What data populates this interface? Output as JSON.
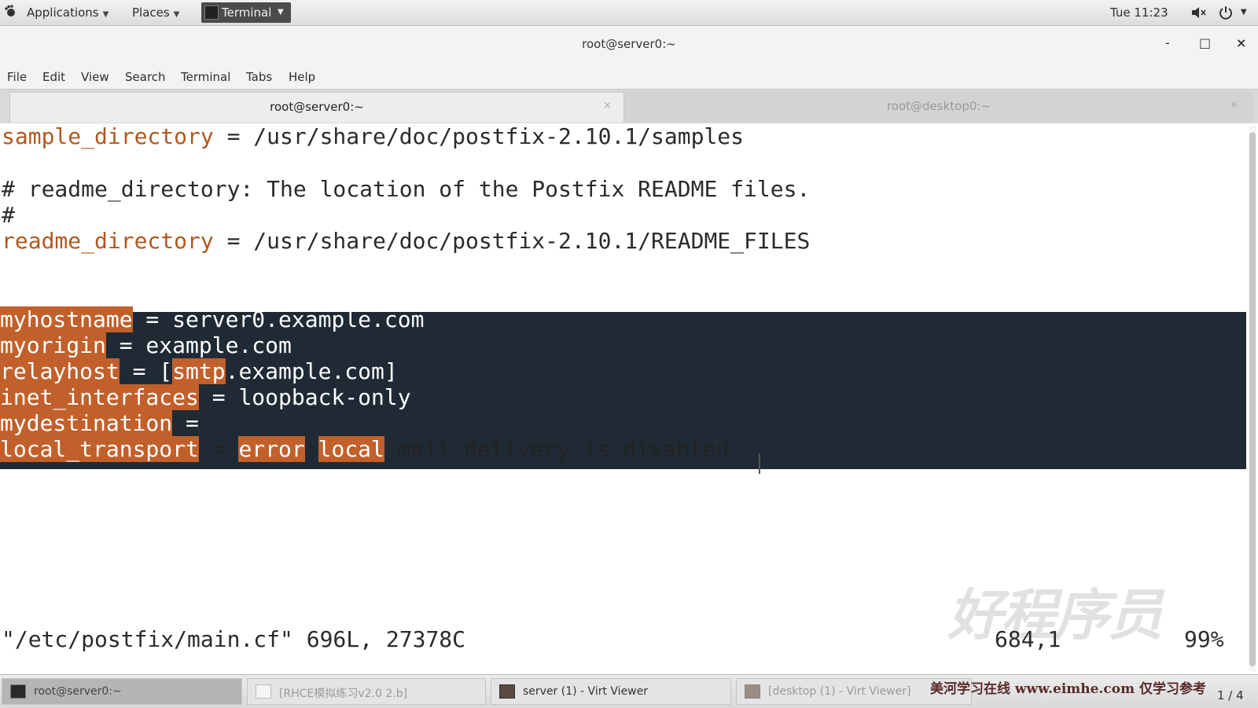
{
  "top_panel": {
    "applications": "Applications",
    "places": "Places",
    "terminal": "Terminal",
    "clock": "Tue 11:23",
    "icons": [
      "gnome-foot-icon",
      "terminal-icon",
      "volume-muted-icon",
      "power-icon"
    ]
  },
  "window": {
    "title": "root@server0:~",
    "minimize": "-",
    "maximize": "□",
    "close": "×"
  },
  "menubar": {
    "file": "File",
    "edit": "Edit",
    "view": "View",
    "search": "Search",
    "terminal": "Terminal",
    "tabs": "Tabs",
    "help": "Help"
  },
  "tabs": [
    {
      "label": "root@server0:~",
      "close": "×",
      "active": true
    },
    {
      "label": "root@desktop0:~",
      "close": "×",
      "active": false
    }
  ],
  "terminal": {
    "lines": {
      "sample_key": "sample_directory",
      "sample_rest": " = /usr/share/doc/postfix-2.10.1/samples",
      "comment1": "# readme_directory: The location of the Postfix README files.",
      "comment2": "#",
      "readme_key": "readme_directory",
      "readme_rest": " = /usr/share/doc/postfix-2.10.1/README_FILES",
      "myhostname_key": "myhostname",
      "myhostname_rest": " = server0.example.com",
      "myorigin_key": "myorigin",
      "myorigin_rest": " = example.com",
      "relayhost_key": "relayhost",
      "relayhost_mid": " = [",
      "relayhost_smtp": "smtp",
      "relayhost_rest": ".example.com]",
      "inet_key": "inet_interfaces",
      "inet_rest": " = loopback-only",
      "mydest_key": "mydestination",
      "mydest_rest": " =",
      "local_key": "local_transport",
      "local_mid": " = ",
      "local_error": "error",
      "local_colon": ":",
      "local_local": "local",
      "local_rest": " mail delivery is disabled"
    },
    "status": "\"/etc/postfix/main.cf\" 696L, 27378C",
    "position": "684,1",
    "percent": "99%",
    "highlight_color": "#c1602b",
    "selection_bg": "#1f2a35",
    "comment_color": "#b0581f"
  },
  "watermark": {
    "logo_text": "好程序员"
  },
  "taskbar": {
    "items": [
      {
        "label": "root@server0:~",
        "icon": "terminal-icon"
      },
      {
        "label": "[RHCE模拟练习v2.0 2.b]",
        "icon": "document-icon"
      },
      {
        "label": "server (1) - Virt Viewer",
        "icon": "virt-viewer-icon"
      },
      {
        "label": "[desktop (1) - Virt Viewer]",
        "icon": "virt-viewer-icon"
      }
    ],
    "promo": "美河学习在线 www.eimhe.com 仅学习参考",
    "pager": "1 / 4"
  }
}
